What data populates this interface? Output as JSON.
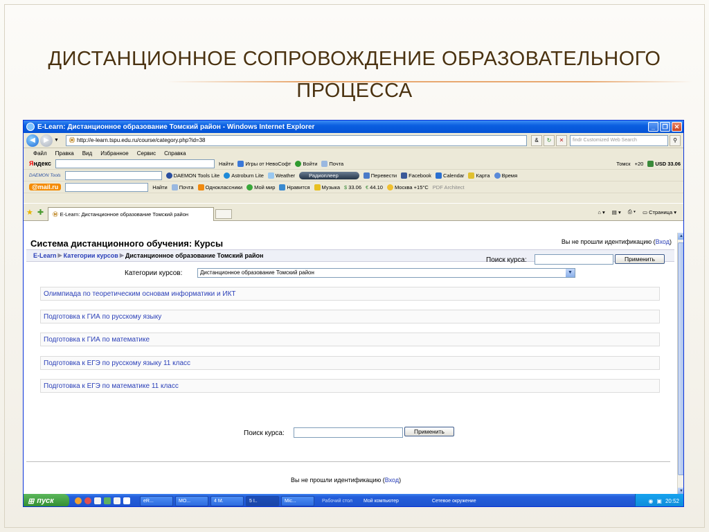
{
  "slide": {
    "title_line1": "ДИСТАНЦИОННОЕ СОПРОВОЖДЕНИЕ ОБРАЗОВАТЕЛЬНОГО",
    "title_line2": "ПРОЦЕССА"
  },
  "window": {
    "title": "E-Learn: Дистанционное образование Томский район - Windows Internet Explorer",
    "url": "http://e-learn.tspu.edu.ru/course/category.php?id=38",
    "search_placeholder": "findr Customized Web Search",
    "menu": [
      "Файл",
      "Правка",
      "Вид",
      "Избранное",
      "Сервис",
      "Справка"
    ]
  },
  "toolbars": {
    "yandex": {
      "logo_y": "Я",
      "logo_rest": "ндекс",
      "find_label": "Найти",
      "games": "Игры от НевоСофт",
      "login": "Войти",
      "mail": "Почта",
      "city_weather": "Томск",
      "temp": "+20",
      "usd": "USD 33.06"
    },
    "daemon": {
      "logo": "DAEMON Tools",
      "tools_lite": "DAEMON Tools Lite",
      "astroburn": "Astroburn Lite",
      "weather": "Weather",
      "radio": "Радиоплеер",
      "translate": "Перевести",
      "facebook": "Facebook",
      "calendar": "Calendar",
      "map": "Карта",
      "time": "Время"
    },
    "mailru": {
      "logo": "@mail.ru",
      "find_label": "Найти",
      "mail": "Почта",
      "classmates": "Одноклассники",
      "myworld": "Мой мир",
      "like": "Нравится",
      "music": "Музыка",
      "usd": "33.06",
      "eur": "44.10",
      "moscow": "Москва +15°C",
      "pdf": "PDF Architect"
    }
  },
  "tab": {
    "label": "E-Learn: Дистанционное образование Томский район",
    "page_menu": "Страница"
  },
  "page": {
    "heading": "Система дистанционного обучения: Курсы",
    "login_prefix": "Вы не прошли идентификацию (",
    "login_link": "Вход",
    "login_suffix": ")",
    "breadcrumbs": [
      "E-Learn",
      "Категории курсов",
      "Дистанционное образование Томский район"
    ],
    "search_label": "Поиск курса:",
    "apply_label": "Применить",
    "categories_label": "Категории курсов:",
    "category_selected": "Дистанционное образование Томский район",
    "courses": [
      "Олимпиада по теоретическим основам информатики и ИКТ",
      "Подготовка к ГИА по русскому языку",
      "Подготовка к ГИА по математике",
      "Подготовка к ЕГЭ по русскому языку 11 класс",
      "Подготовка к ЕГЭ по математике 11 класс"
    ]
  },
  "taskbar": {
    "start": "пуск",
    "items": [
      "eR...",
      "МО...",
      "4 М.",
      "5 I..",
      "Mic..."
    ],
    "desktop": "Рабочий стол",
    "my_computer": "Мой компьютер",
    "network": "Сетевое окружение",
    "clock": "20:52"
  },
  "colors": {
    "title_color": "#4a3210",
    "link_color": "#2a3fb8",
    "xp_blue": "#245edb",
    "start_green": "#2f8a2f"
  }
}
